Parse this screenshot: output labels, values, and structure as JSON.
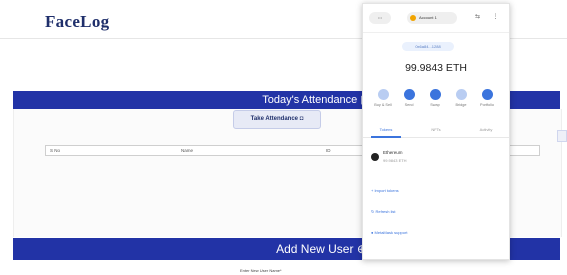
{
  "app": {
    "logo": "FaceLog"
  },
  "attendance": {
    "title": "Today's Attendance",
    "title_icon": "calendar-icon",
    "take_button": "Take Attendance",
    "take_icon": "camera-icon",
    "columns": [
      "S No",
      "Name",
      "ID"
    ]
  },
  "add_user": {
    "title": "Add New User",
    "title_icon": "user-plus-icon",
    "subtitle": "Enter New User Name*"
  },
  "wallet": {
    "network_label": "•••",
    "account_label": "Account 1",
    "address": "0x6a84...1288",
    "balance": "99.9843 ETH",
    "actions": [
      "Buy & Sell",
      "Send",
      "Swap",
      "Bridge",
      "Portfolio"
    ],
    "tabs": [
      "Tokens",
      "NFTs",
      "Activity"
    ],
    "asset": {
      "name": "Ethereum",
      "amount": "99.9843 ETH"
    },
    "links": [
      "+ Import tokens",
      "↻ Refresh list",
      "● MetaMask support"
    ],
    "accent": "#3b74dd"
  },
  "colors": {
    "header_band": "#2233a6",
    "logo": "#1f2f6b"
  }
}
